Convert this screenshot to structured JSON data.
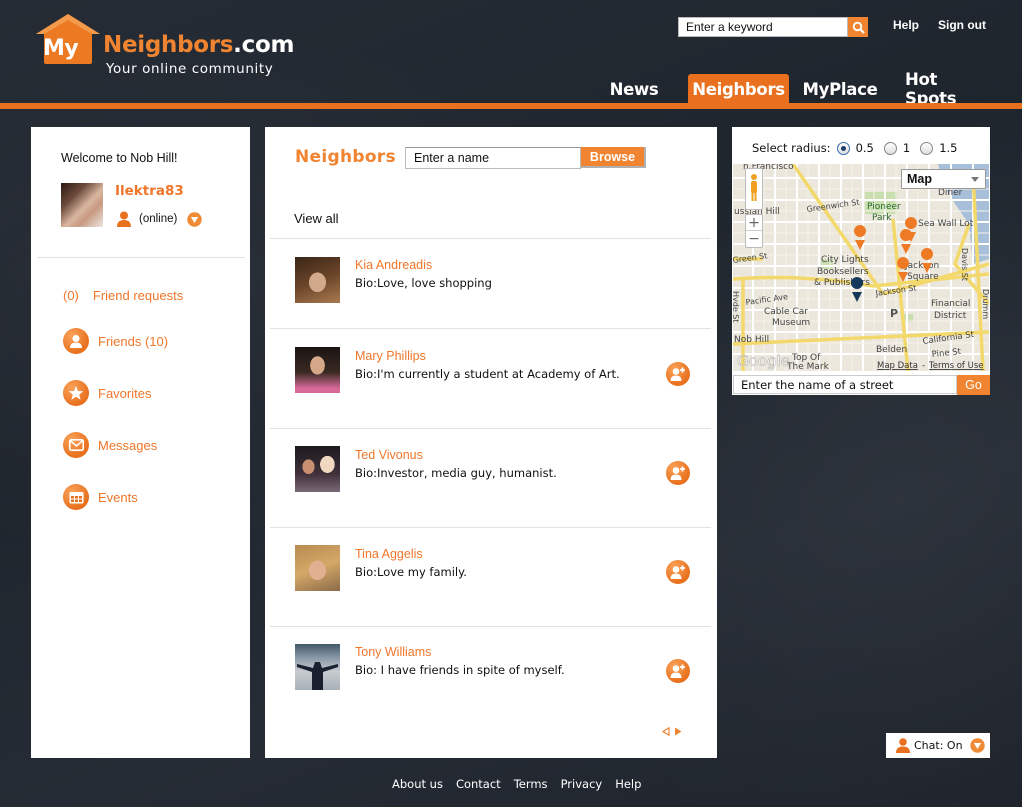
{
  "brand": {
    "my": "My",
    "name": "Neighbors",
    "tld": ".com",
    "tagline": "Your online community",
    "accent": "#e8701e"
  },
  "header": {
    "search_placeholder": "Enter a keyword",
    "search_icon": "magnifier-icon",
    "links": [
      "Help",
      "Sign out"
    ],
    "nav": [
      {
        "label": "News",
        "active": false
      },
      {
        "label": "Neighbors",
        "active": true
      },
      {
        "label": "MyPlace",
        "active": false
      },
      {
        "label": "Hot Spots",
        "active": false
      }
    ]
  },
  "profile": {
    "welcome": "Welcome to Nob Hill!",
    "username": "Ilektra83",
    "status": "(online)"
  },
  "sidebar": {
    "friend_requests": {
      "count": "(0)",
      "label": "Friend requests"
    },
    "items": [
      {
        "label": "Friends (10)",
        "icon": "person-icon"
      },
      {
        "label": "Favorites",
        "icon": "star-icon"
      },
      {
        "label": "Messages",
        "icon": "envelope-icon"
      },
      {
        "label": "Events",
        "icon": "calendar-icon"
      }
    ]
  },
  "neighbors": {
    "title": "Neighbors",
    "name_placeholder": "Enter a name",
    "browse_label": "Browse",
    "view_all": "View all",
    "list": [
      {
        "name": "Kia Andreadis",
        "bio": "Bio:Love, love shopping",
        "can_add": false
      },
      {
        "name": "Mary Phillips",
        "bio": "Bio:I'm currently a student at Academy of Art.",
        "can_add": true
      },
      {
        "name": "Ted Vivonus",
        "bio": "Bio:Investor, media guy, humanist.",
        "can_add": true
      },
      {
        "name": "Tina Aggelis",
        "bio": "Bio:Love my family.",
        "can_add": true
      },
      {
        "name": "Tony Williams",
        "bio": "Bio: I have friends in spite of myself.",
        "can_add": true
      }
    ]
  },
  "map_panel": {
    "radius_label": "Select radius:",
    "radius_options": [
      "0.5",
      "1",
      "1.5"
    ],
    "radius_selected": "0.5",
    "map_type": "Map",
    "labels": {
      "sf": "n Francisco",
      "russian_hill": "ussian Hill",
      "greenwich": "Greenwich St",
      "pioneer": "Pioneer",
      "park": "Park",
      "diner": "Diner",
      "sea_wall": "Sea Wall Lot",
      "green_st": "Green St",
      "city_lights": "City Lights",
      "booksellers": "Booksellers",
      "publishers": "& Publishers",
      "jackson_sq1": "Jackson",
      "jackson_sq2": "Square",
      "jackson_st": "Jackson St",
      "davis": "Davis St",
      "drumm": "Drumm",
      "hyde": "Hyde St",
      "pacific": "Pacific Ave",
      "cable_car": "Cable Car",
      "museum": "Museum",
      "financial": "Financial",
      "district": "District",
      "nob_hill": "Nob Hill",
      "california": "California St",
      "pine": "Pine St",
      "belden": "Belden",
      "top_of": "Top Of",
      "the_mark": "The Mark",
      "google": "Google",
      "map_data": "Map Data",
      "sep": "-",
      "terms": "Terms of Use"
    },
    "street_placeholder": "Enter the name of a street",
    "go_label": "Go"
  },
  "chat": {
    "label": "Chat: On"
  },
  "footer": {
    "links": [
      "About us",
      "Contact",
      "Terms",
      "Privacy",
      "Help"
    ]
  }
}
